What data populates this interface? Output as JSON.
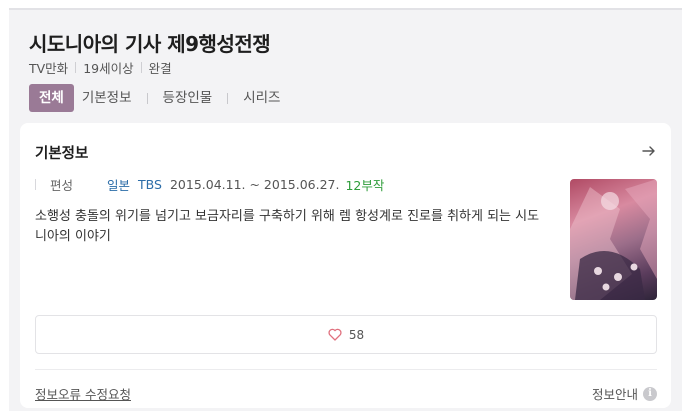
{
  "header": {
    "title": "시도니아의 기사 제9행성전쟁",
    "meta": [
      "TV만화",
      "19세이상",
      "완결"
    ]
  },
  "tabs": [
    {
      "label": "전체",
      "active": true
    },
    {
      "label": "기본정보",
      "active": false
    },
    {
      "label": "등장인물",
      "active": false
    },
    {
      "label": "시리즈",
      "active": false
    }
  ],
  "card": {
    "title": "기본정보",
    "arrow_icon": "arrow-right-icon",
    "info": {
      "label": "편성",
      "country": "일본",
      "channel": "TBS",
      "dates": "2015.04.11. ~ 2015.06.27.",
      "episodes": "12부작"
    },
    "synopsis": "소행성 충돌의 위기를 넘기고 보금자리를 구축하기 위해 렘 항성계로 진로를 취하게 되는 시도니아의 이야기",
    "like": {
      "icon": "heart-outline-icon",
      "count": "58"
    },
    "footer": {
      "report_label": "정보오류 수정요청",
      "guide_label": "정보안내",
      "guide_icon": "info-icon"
    }
  },
  "colors": {
    "tab_active_bg": "#9a7a96",
    "link": "#2c6da8",
    "episodes": "#2f9d3b",
    "heart": "#e0707e"
  }
}
